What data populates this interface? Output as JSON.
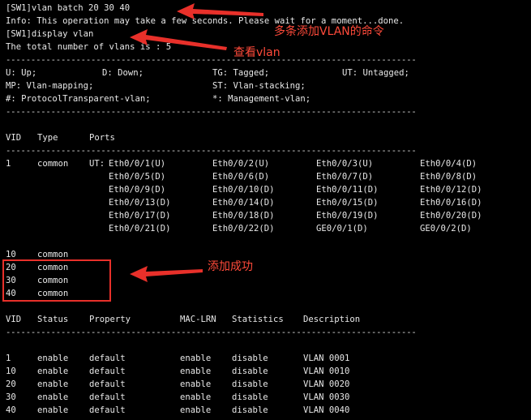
{
  "terminal": {
    "lines": {
      "cmd_batch": "[SW1]vlan batch 20 30 40",
      "info": "Info: This operation may take a few seconds. Please wait for a moment...done.",
      "cmd_display": "[SW1]display vlan",
      "total": "The total number of vlans is : 5"
    },
    "dashes": "----------------------------------------------------------------------------------",
    "legend": {
      "row1": [
        "U: Up;",
        "D: Down;",
        "TG: Tagged;",
        "UT: Untagged;"
      ],
      "row2": [
        "MP: Vlan-mapping;",
        "ST: Vlan-stacking;"
      ],
      "row3": [
        "#: ProtocolTransparent-vlan;",
        "*: Management-vlan;"
      ]
    },
    "port_table": {
      "headers": [
        "VID",
        "Type",
        "Ports"
      ],
      "vlan1": {
        "vid": "1",
        "type": "common",
        "prefix": "UT:",
        "ports": [
          [
            "Eth0/0/1(U)",
            "Eth0/0/2(U)",
            "Eth0/0/3(U)",
            "Eth0/0/4(D)"
          ],
          [
            "Eth0/0/5(D)",
            "Eth0/0/6(D)",
            "Eth0/0/7(D)",
            "Eth0/0/8(D)"
          ],
          [
            "Eth0/0/9(D)",
            "Eth0/0/10(D)",
            "Eth0/0/11(D)",
            "Eth0/0/12(D)"
          ],
          [
            "Eth0/0/13(D)",
            "Eth0/0/14(D)",
            "Eth0/0/15(D)",
            "Eth0/0/16(D)"
          ],
          [
            "Eth0/0/17(D)",
            "Eth0/0/18(D)",
            "Eth0/0/19(D)",
            "Eth0/0/20(D)"
          ],
          [
            "Eth0/0/21(D)",
            "Eth0/0/22(D)",
            "GE0/0/1(D)",
            "GE0/0/2(D)"
          ]
        ]
      },
      "other_vlans": [
        {
          "vid": "10",
          "type": "common"
        },
        {
          "vid": "20",
          "type": "common"
        },
        {
          "vid": "30",
          "type": "common"
        },
        {
          "vid": "40",
          "type": "common"
        }
      ]
    },
    "status_table": {
      "headers": [
        "VID",
        "Status",
        "Property",
        "MAC-LRN",
        "Statistics",
        "Description"
      ],
      "rows": [
        [
          "1",
          "enable",
          "default",
          "enable",
          "disable",
          "VLAN 0001"
        ],
        [
          "10",
          "enable",
          "default",
          "enable",
          "disable",
          "VLAN 0010"
        ],
        [
          "20",
          "enable",
          "default",
          "enable",
          "disable",
          "VLAN 0020"
        ],
        [
          "30",
          "enable",
          "default",
          "enable",
          "disable",
          "VLAN 0030"
        ],
        [
          "40",
          "enable",
          "default",
          "enable",
          "disable",
          "VLAN 0040"
        ]
      ]
    }
  },
  "annotations": {
    "batch_cmd_note": "多条添加VLAN的命令",
    "display_note": "查看vlan",
    "success_note": "添加成功",
    "color": "#ff4a3a"
  }
}
